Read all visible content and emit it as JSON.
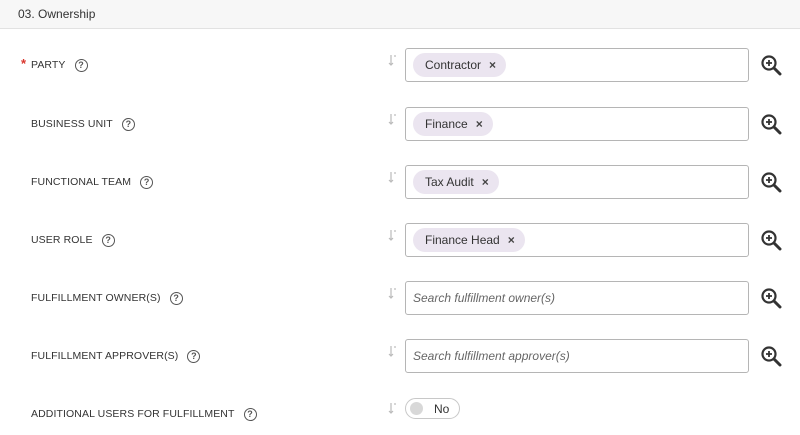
{
  "section": {
    "title": "03. Ownership"
  },
  "fields": [
    {
      "label": "PARTY",
      "required": true,
      "chip": "Contractor"
    },
    {
      "label": "BUSINESS UNIT",
      "chip": "Finance"
    },
    {
      "label": "FUNCTIONAL TEAM",
      "chip": "Tax Audit"
    },
    {
      "label": "USER ROLE",
      "chip": "Finance Head"
    },
    {
      "label": "FULFILLMENT OWNER(S)",
      "placeholder": "Search fulfillment owner(s)"
    },
    {
      "label": "FULFILLMENT APPROVER(S)",
      "placeholder": "Search fulfillment approver(s)"
    },
    {
      "label": "ADDITIONAL USERS FOR FULFILLMENT",
      "toggle_value": "No"
    }
  ],
  "icons": {
    "help": "question-circle-icon",
    "sort": "sort-arrow-icon",
    "lookup": "zoom-in-icon",
    "remove": "close-icon"
  },
  "glyphs": {
    "help": "?",
    "remove": "×",
    "required": "*"
  },
  "colors": {
    "chip_bg": "#ebe5f0",
    "required": "#d9342b",
    "header_bg": "#f7f7f7"
  }
}
